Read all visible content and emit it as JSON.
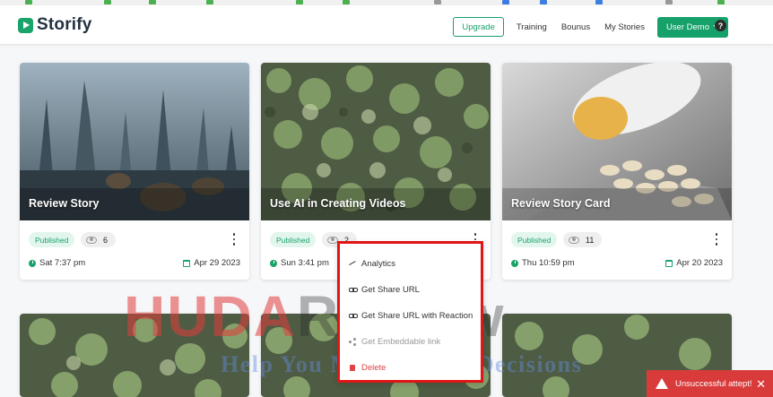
{
  "app": {
    "logo_text": "Storify"
  },
  "nav": {
    "upgrade": "Upgrade",
    "training": "Training",
    "bonus": "Bounus",
    "my_stories": "My Stories",
    "user": "User Demo",
    "help": "?"
  },
  "cards": [
    {
      "title": "Review Story",
      "status": "Published",
      "views": "6",
      "time": "Sat 7:37 pm",
      "date": "Apr 29 2023"
    },
    {
      "title": "Use AI in Creating Videos",
      "status": "Published",
      "views": "2",
      "time": "Sun 3:41 pm",
      "date": ""
    },
    {
      "title": "Review Story Card",
      "status": "Published",
      "views": "11",
      "time": "Thu 10:59 pm",
      "date": "Apr 20 2023"
    }
  ],
  "menu": {
    "analytics": "Analytics",
    "share_url": "Get Share URL",
    "share_reaction": "Get Share URL with Reaction",
    "embeddable": "Get Embeddable link",
    "delete": "Delete"
  },
  "watermark": {
    "line1a": "HUDA",
    "line1b": "Review",
    "line2": "Help You Make Better Decisions"
  },
  "toast": {
    "message": "Unsuccessful attept!",
    "close": "✕"
  },
  "colors": {
    "brand": "#1aa36b",
    "danger": "#d93a3a",
    "highlight": "#e01515"
  }
}
